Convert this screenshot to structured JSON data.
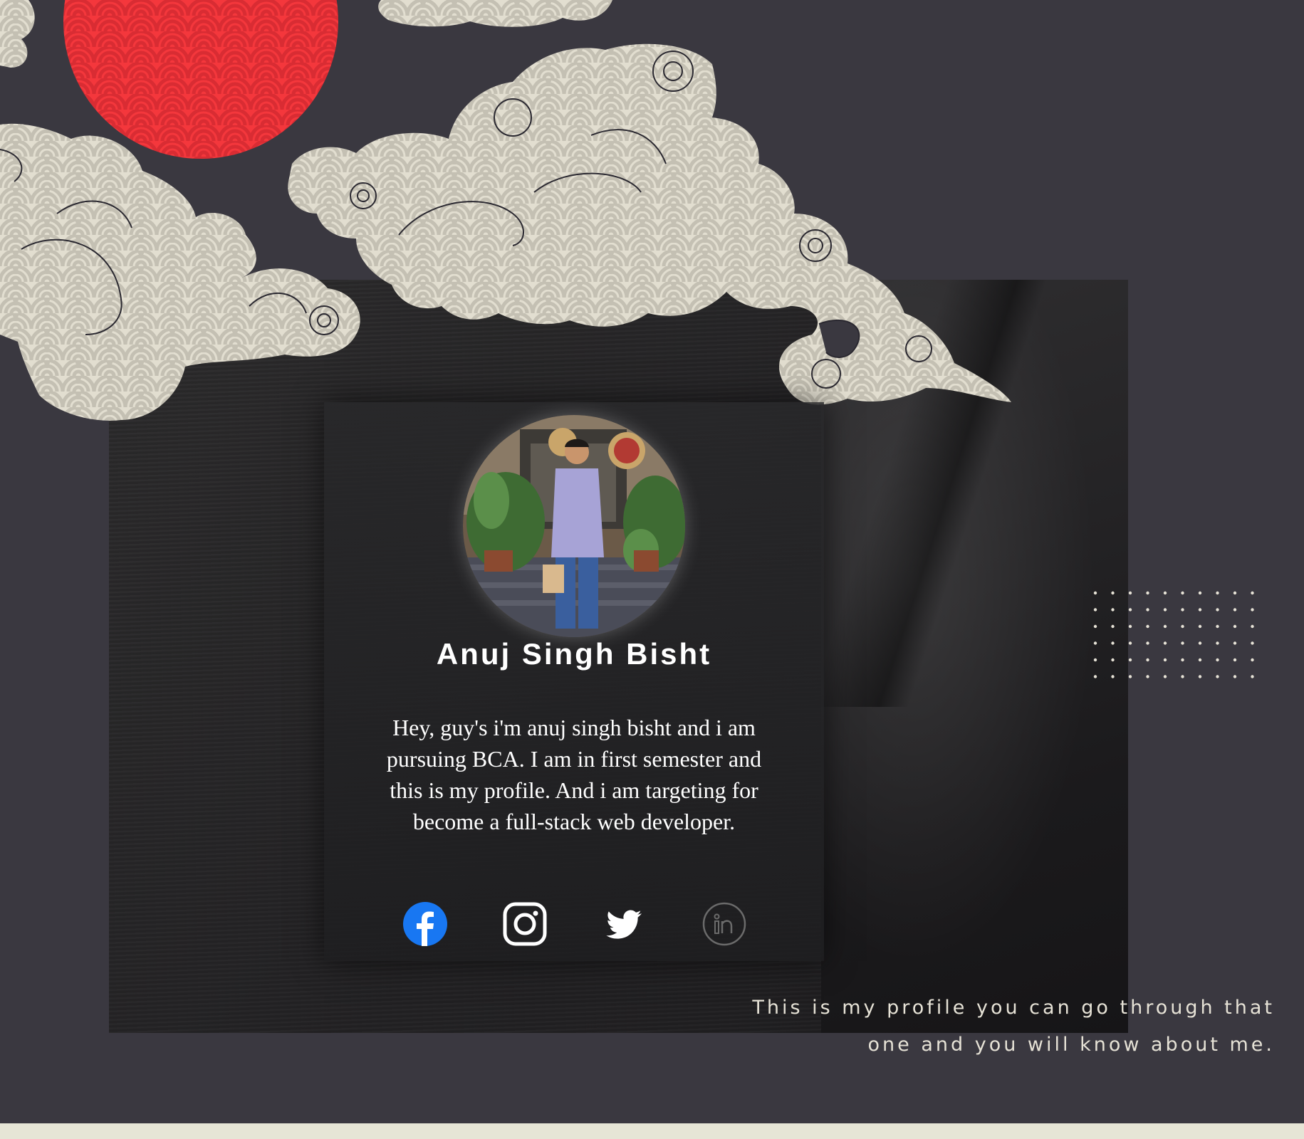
{
  "profile": {
    "name": "Anuj Singh Bisht",
    "bio": "Hey, guy's i'm anuj singh bisht and i am pursuing BCA. I am in first semester and this is my profile. And i am targeting for become a full-stack web developer."
  },
  "social": [
    {
      "name": "facebook",
      "icon": "facebook-icon",
      "color": "#1877f2"
    },
    {
      "name": "instagram",
      "icon": "instagram-icon",
      "color": "#ffffff"
    },
    {
      "name": "twitter",
      "icon": "twitter-icon",
      "color": "#ffffff"
    },
    {
      "name": "linkedin",
      "icon": "linkedin-icon",
      "color": "#6b6b6b"
    }
  ],
  "caption": {
    "line1": "This is my profile you can go through that",
    "line2": "one and you will know about me."
  },
  "colors": {
    "background": "#3a3840",
    "sun": "#f4373c",
    "cloud": "#e2ded0",
    "bottom_strip": "#e6e5d6"
  }
}
